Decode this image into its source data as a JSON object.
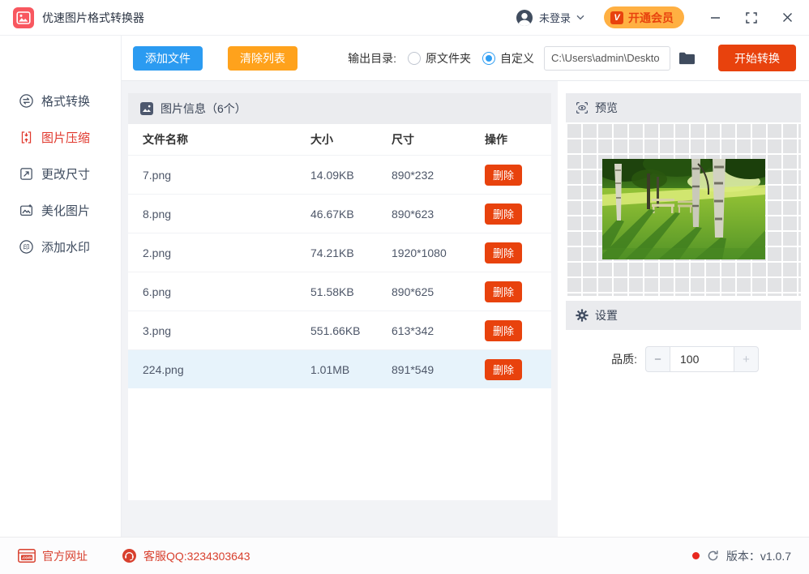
{
  "window": {
    "title": "优速图片格式转换器",
    "login_status": "未登录",
    "vip_badge": "V",
    "vip_button": "开通会员"
  },
  "toolbar": {
    "add_files": "添加文件",
    "clear_list": "清除列表",
    "output_dir_label": "输出目录:",
    "radio_original": "原文件夹",
    "radio_custom": "自定义",
    "output_path": "C:\\Users\\admin\\Deskto",
    "start_convert": "开始转换"
  },
  "sidebar": {
    "items": [
      {
        "id": "convert",
        "label": "格式转换",
        "active": false
      },
      {
        "id": "compress",
        "label": "图片压缩",
        "active": true
      },
      {
        "id": "resize",
        "label": "更改尺寸",
        "active": false
      },
      {
        "id": "beautify",
        "label": "美化图片",
        "active": false
      },
      {
        "id": "watermark",
        "label": "添加水印",
        "active": false
      }
    ]
  },
  "file_table": {
    "title": "图片信息（6个）",
    "columns": [
      "文件名称",
      "大小",
      "尺寸",
      "操作"
    ],
    "delete_label": "删除",
    "rows": [
      {
        "name": "7.png",
        "size": "14.09KB",
        "dimensions": "890*232",
        "selected": false
      },
      {
        "name": "8.png",
        "size": "46.67KB",
        "dimensions": "890*623",
        "selected": false
      },
      {
        "name": "2.png",
        "size": "74.21KB",
        "dimensions": "1920*1080",
        "selected": false
      },
      {
        "name": "6.png",
        "size": "51.58KB",
        "dimensions": "890*625",
        "selected": false
      },
      {
        "name": "3.png",
        "size": "551.66KB",
        "dimensions": "613*342",
        "selected": false
      },
      {
        "name": "224.png",
        "size": "1.01MB",
        "dimensions": "891*549",
        "selected": true
      }
    ]
  },
  "preview": {
    "title": "预览"
  },
  "settings": {
    "title": "设置",
    "quality_label": "品质:",
    "quality_value": "100",
    "minus": "−",
    "plus": "+"
  },
  "footer": {
    "website": "官方网址",
    "qq": "客服QQ:3234303643",
    "version": "版本：v1.0.7"
  },
  "colors": {
    "accent_blue": "#2b9bf1",
    "accent_orange": "#ffa21c",
    "accent_red": "#e8420d",
    "vip_pill": "#ffb042",
    "sidebar_active": "#e0382d",
    "selected_row": "#e7f3fb",
    "footer_red": "#d8402e"
  }
}
